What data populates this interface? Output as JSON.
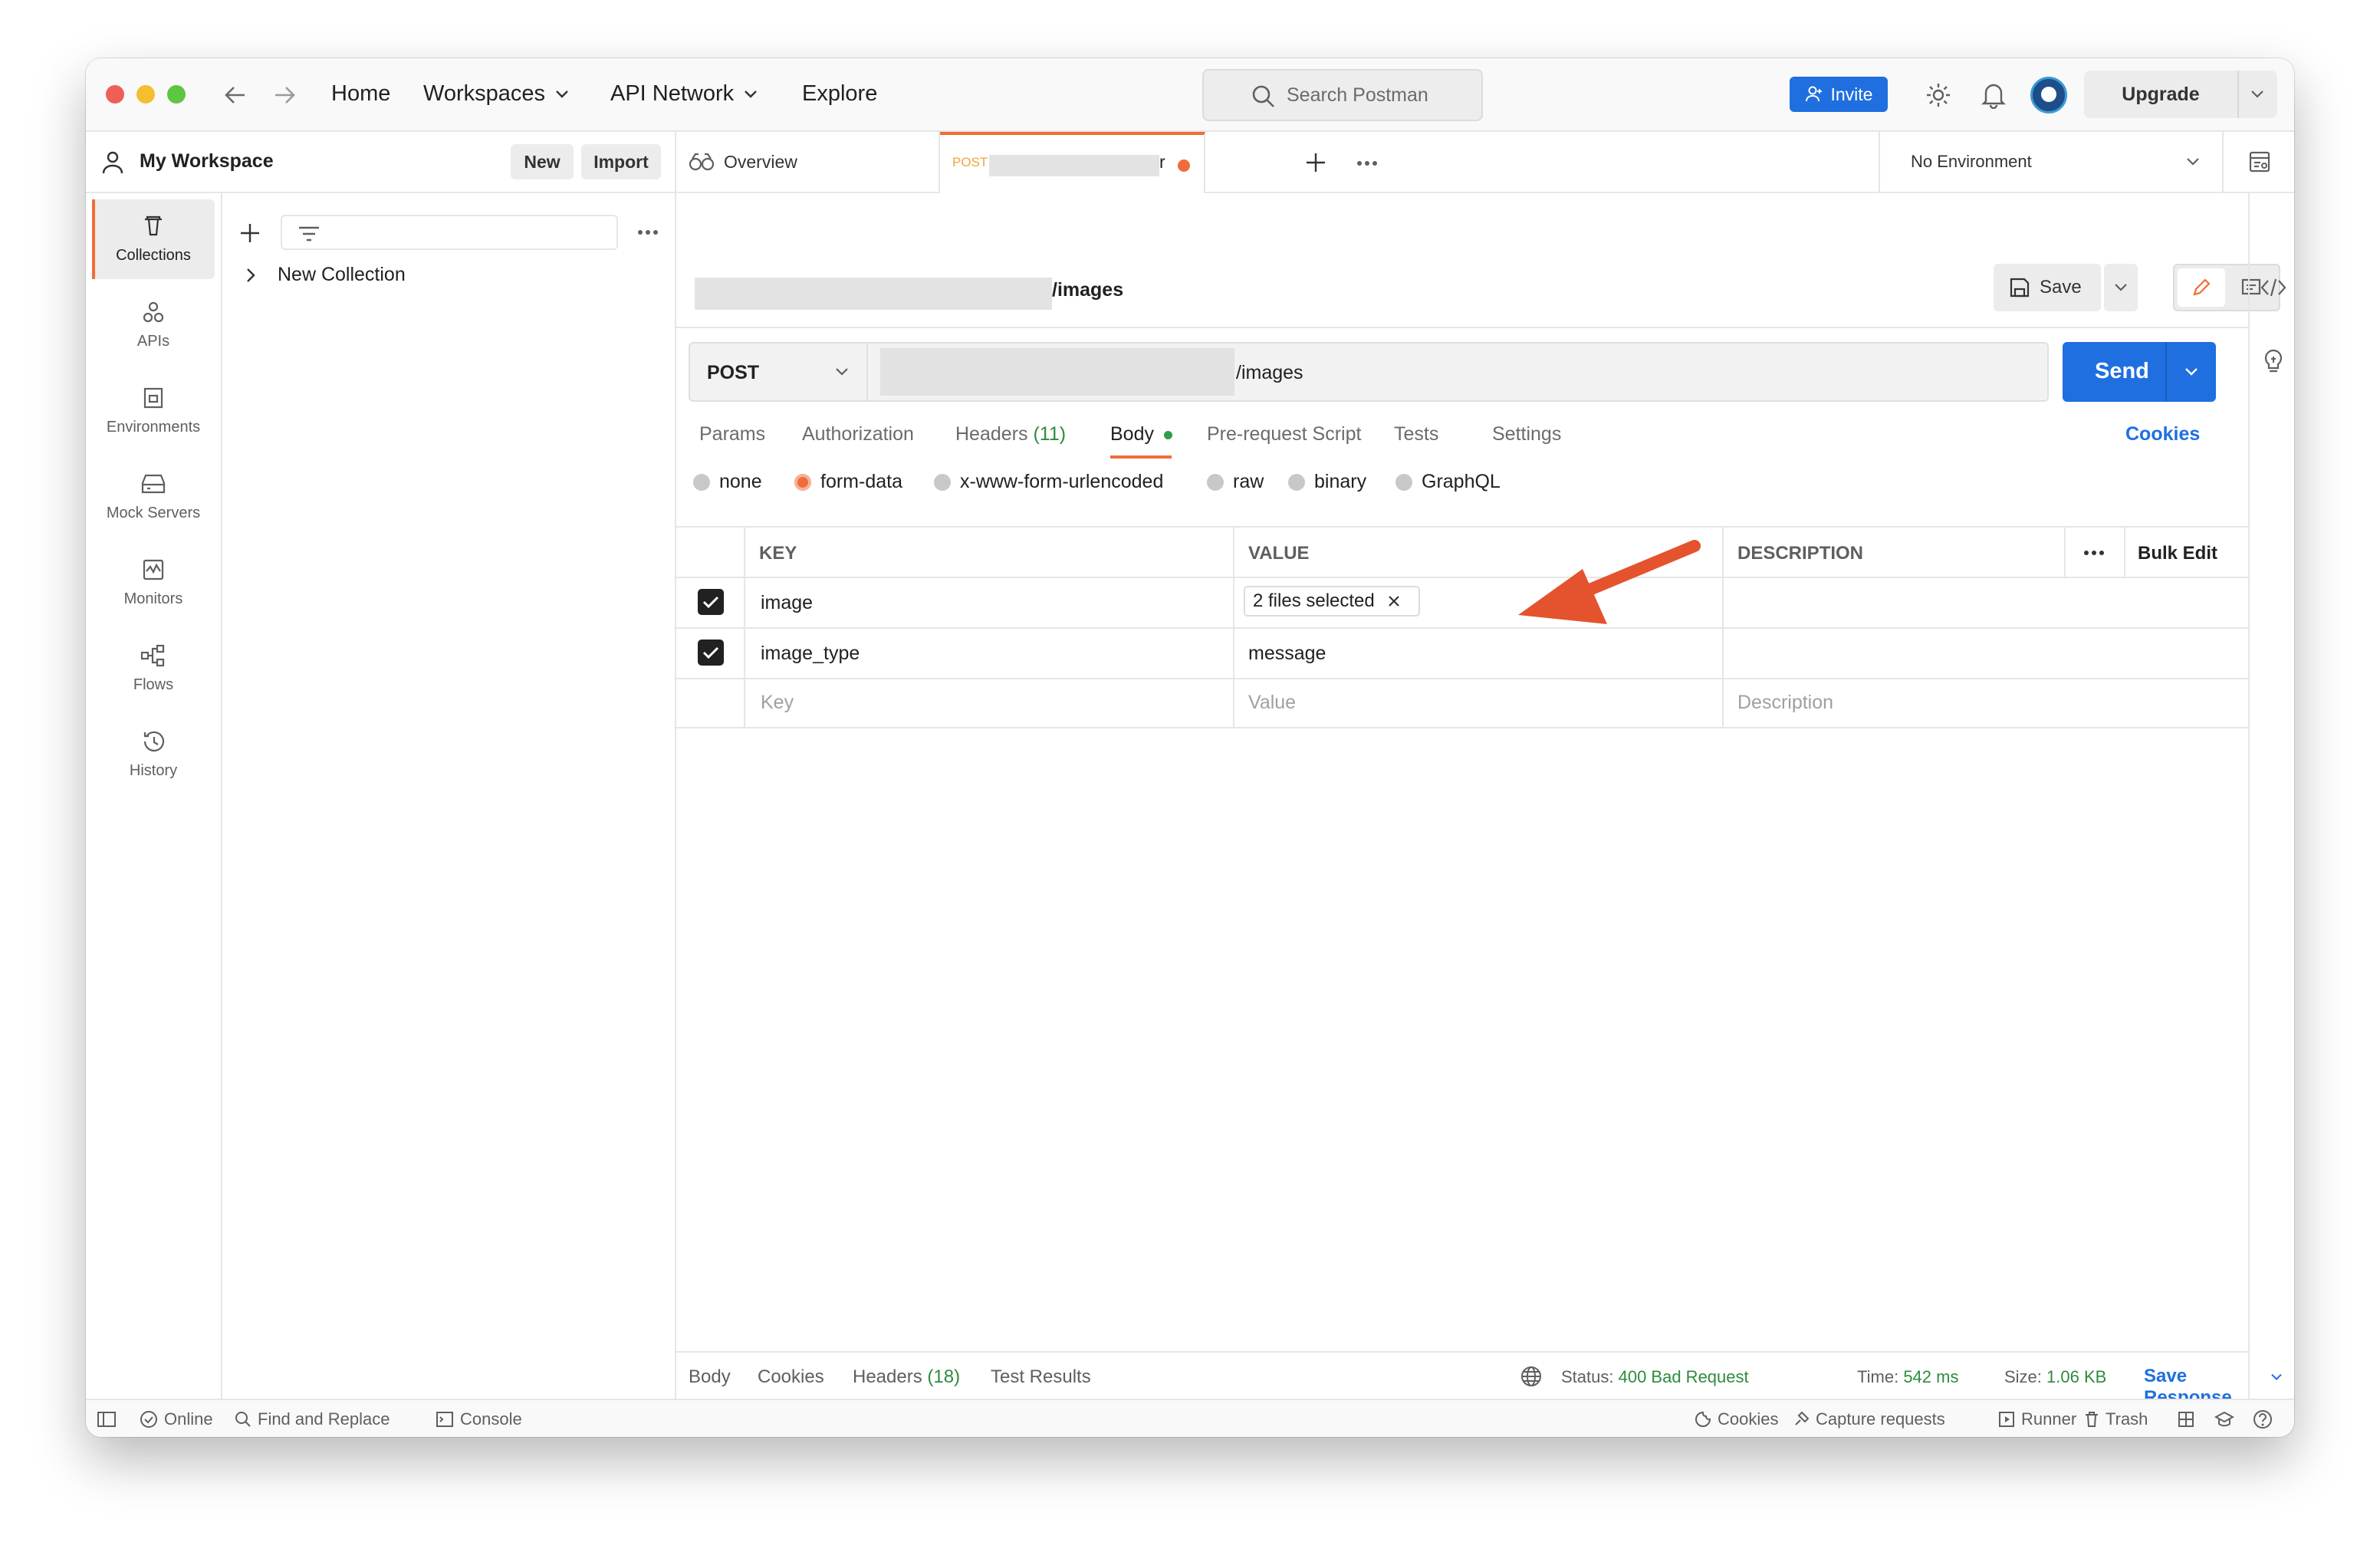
{
  "titlebar": {
    "nav": {
      "home": "Home",
      "workspaces": "Workspaces",
      "api_network": "API Network",
      "explore": "Explore"
    },
    "search_placeholder": "Search Postman",
    "invite": "Invite",
    "upgrade": "Upgrade"
  },
  "workspace": {
    "name": "My Workspace",
    "new": "New",
    "import": "Import"
  },
  "sidebar": {
    "items": [
      {
        "label": "Collections",
        "icon": "trash-can-icon",
        "active": true
      },
      {
        "label": "APIs",
        "icon": "apis-icon"
      },
      {
        "label": "Environments",
        "icon": "environments-icon"
      },
      {
        "label": "Mock Servers",
        "icon": "mock-server-icon"
      },
      {
        "label": "Monitors",
        "icon": "monitor-icon"
      },
      {
        "label": "Flows",
        "icon": "flows-icon"
      },
      {
        "label": "History",
        "icon": "history-icon"
      }
    ]
  },
  "collections": [
    {
      "label": "New Collection"
    }
  ],
  "tabs": {
    "overview": "Overview",
    "request_method": "POST",
    "request_name_suffix": "r",
    "environment": "No Environment"
  },
  "request": {
    "breadcrumb_suffix": "/images",
    "save": "Save",
    "method": "POST",
    "url_suffix": "/images",
    "send": "Send",
    "tabs": [
      "Params",
      "Authorization",
      "Headers",
      "Body",
      "Pre-request Script",
      "Tests",
      "Settings"
    ],
    "headers_count": "(11)",
    "cookies": "Cookies",
    "body_modes": [
      "none",
      "form-data",
      "x-www-form-urlencoded",
      "raw",
      "binary",
      "GraphQL"
    ],
    "selected_body_mode": "form-data"
  },
  "form_table": {
    "headers": {
      "key": "KEY",
      "value": "VALUE",
      "description": "DESCRIPTION",
      "bulk_edit": "Bulk Edit"
    },
    "rows": [
      {
        "key": "image",
        "value": "2 files selected",
        "checked": true
      },
      {
        "key": "image_type",
        "value": "message",
        "checked": true
      }
    ],
    "placeholders": {
      "key": "Key",
      "value": "Value",
      "description": "Description"
    }
  },
  "response": {
    "tabs": [
      "Body",
      "Cookies",
      "Headers",
      "Test Results"
    ],
    "headers_count": "(18)",
    "status_label": "Status:",
    "status_value": "400 Bad Request",
    "time_label": "Time:",
    "time_value": "542 ms",
    "size_label": "Size:",
    "size_value": "1.06 KB",
    "save_response": "Save Response"
  },
  "footer": {
    "online": "Online",
    "find_replace": "Find and Replace",
    "console": "Console",
    "cookies": "Cookies",
    "capture": "Capture requests",
    "runner": "Runner",
    "trash": "Trash"
  },
  "colors": {
    "accent": "#1f6fe0",
    "orange": "#f26b3a",
    "green": "#2e8b3d",
    "annotation_arrow": "#e4532d"
  }
}
